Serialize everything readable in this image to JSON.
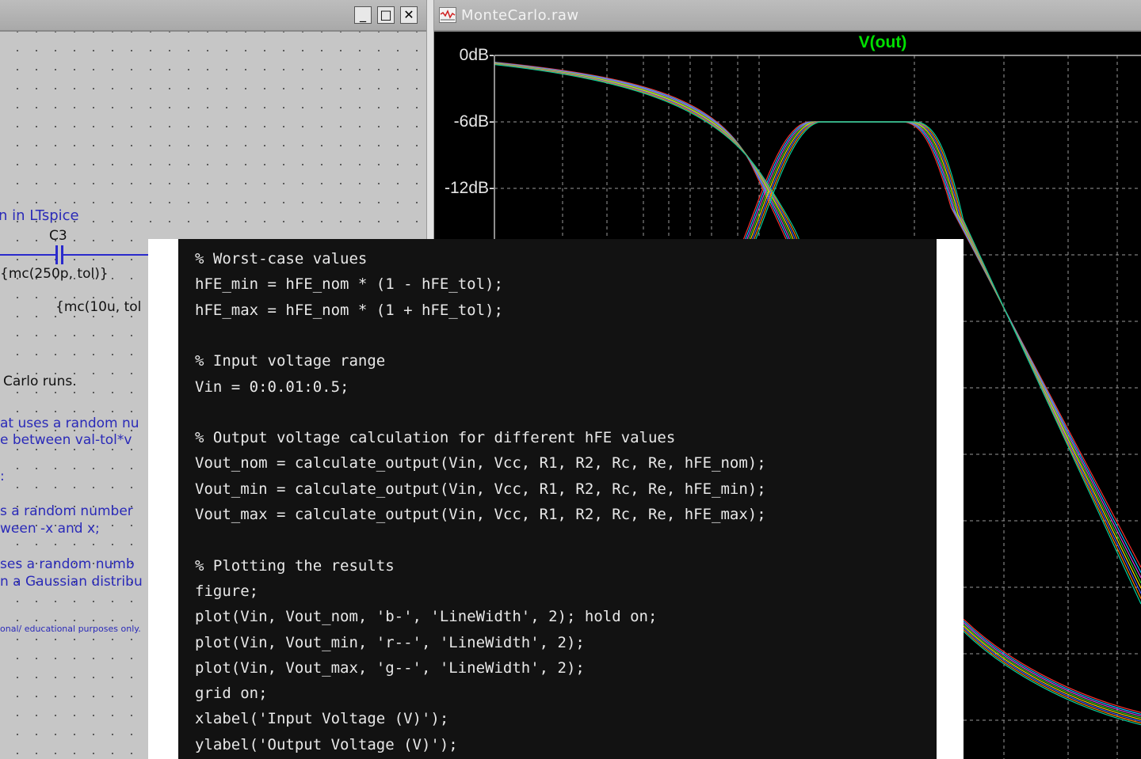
{
  "schematic": {
    "window_buttons": {
      "minimize": "_",
      "maximize": "□",
      "close": "✕"
    },
    "texts": {
      "in_ltspice": "n in LTspice",
      "c3_label": "C3",
      "c3_value": "{mc(250p, tol)}",
      "second_value": "{mc(10u, tol",
      "carlo_runs": "Carlo runs.",
      "random_line1": "at uses a random nu",
      "random_line2": "e between val-tol*v",
      "colon": ":",
      "flat_line1": "s a random number",
      "flat_line2": "ween -x and x;",
      "gauss_line1": "ses a random numb",
      "gauss_line2": "n a Gaussian distribu",
      "footnote": "onal/ educational purposes only."
    }
  },
  "waveform": {
    "window_title": "MonteCarlo.raw",
    "trace_name": "V(out)",
    "y_ticks": [
      "0dB-",
      "-6dB-",
      "-12dB-"
    ],
    "colors": {
      "trace_label": "#00e000",
      "grid": "#9a9a9a",
      "traces": [
        "#ff3030",
        "#00c0ff",
        "#e040e0",
        "#30d030",
        "#ffd000",
        "#4060ff",
        "#ff8000",
        "#00d0a0"
      ]
    }
  },
  "code": {
    "lines": [
      "% Worst-case values",
      "hFE_min = hFE_nom * (1 - hFE_tol);",
      "hFE_max = hFE_nom * (1 + hFE_tol);",
      "",
      "% Input voltage range",
      "Vin = 0:0.01:0.5;",
      "",
      "% Output voltage calculation for different hFE values",
      "Vout_nom = calculate_output(Vin, Vcc, R1, R2, Rc, Re, hFE_nom);",
      "Vout_min = calculate_output(Vin, Vcc, R1, R2, Rc, Re, hFE_min);",
      "Vout_max = calculate_output(Vin, Vcc, R1, R2, Rc, Re, hFE_max);",
      "",
      "% Plotting the results",
      "figure;",
      "plot(Vin, Vout_nom, 'b-', 'LineWidth', 2); hold on;",
      "plot(Vin, Vout_min, 'r--', 'LineWidth', 2);",
      "plot(Vin, Vout_max, 'g--', 'LineWidth', 2);",
      "grid on;",
      "xlabel('Input Voltage (V)');",
      "ylabel('Output Voltage (V)');"
    ]
  }
}
